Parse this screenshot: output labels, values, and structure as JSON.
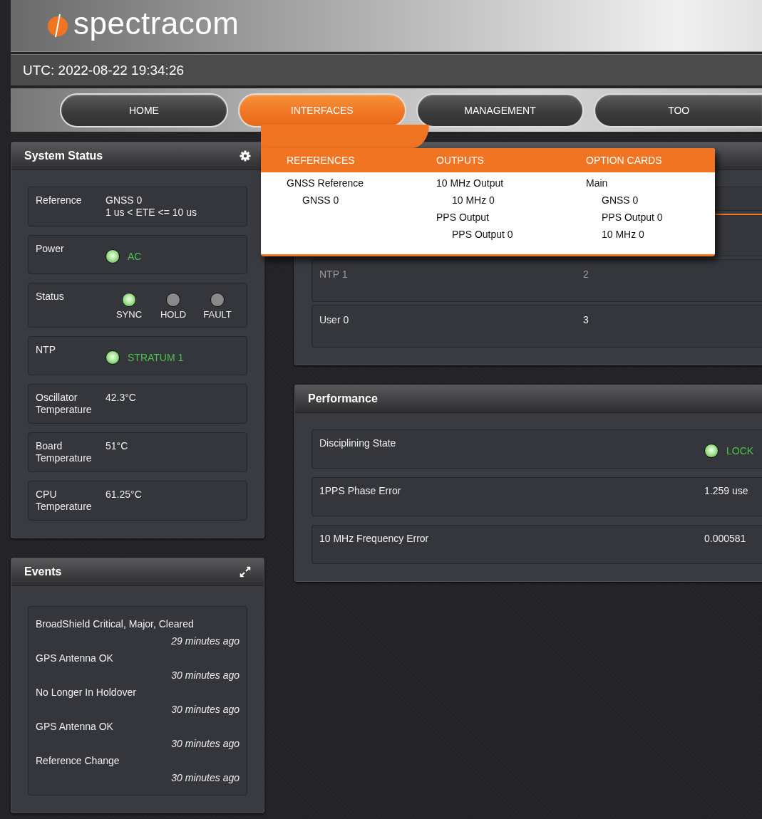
{
  "header": {
    "logo": "spectracom",
    "utc": "UTC: 2022-08-22 19:34:26"
  },
  "nav": {
    "tabs": [
      {
        "label": "HOME",
        "selected": false
      },
      {
        "label": "INTERFACES",
        "selected": true
      },
      {
        "label": "MANAGEMENT",
        "selected": false
      },
      {
        "label": "TOO",
        "selected": false
      }
    ]
  },
  "menu": {
    "columns": [
      {
        "heading": "REFERENCES",
        "items": [
          {
            "label": "GNSS Reference",
            "children": [
              {
                "label": "GNSS 0"
              }
            ]
          }
        ]
      },
      {
        "heading": "OUTPUTS",
        "items": [
          {
            "label": "10 MHz Output",
            "children": [
              {
                "label": "10 MHz 0"
              }
            ]
          },
          {
            "label": "PPS Output",
            "children": [
              {
                "label": "PPS Output 0"
              }
            ]
          }
        ]
      },
      {
        "heading": "OPTION CARDS",
        "items": [
          {
            "label": "Main",
            "children": [
              {
                "label": "GNSS 0"
              },
              {
                "label": "PPS Output 0"
              },
              {
                "label": "10 MHz 0"
              }
            ]
          }
        ]
      }
    ]
  },
  "system_status": {
    "title": "System Status",
    "rows": [
      {
        "kind": "text",
        "label": "Reference",
        "lines": [
          "GNSS 0",
          "1 us < ETE <= 10 us"
        ]
      },
      {
        "kind": "led",
        "label": "Power",
        "leds": [
          {
            "label": "AC",
            "on": true
          }
        ]
      },
      {
        "kind": "indicators",
        "label": "Status",
        "leds": [
          {
            "label": "SYNC",
            "on": true
          },
          {
            "label": "HOLD",
            "on": false
          },
          {
            "label": "FAULT",
            "on": false
          }
        ]
      },
      {
        "kind": "led",
        "label": "NTP",
        "leds": [
          {
            "label": "STRATUM 1",
            "on": true
          }
        ]
      },
      {
        "kind": "text",
        "label": "Oscillator Temperature",
        "lines": [
          "42.3°C"
        ]
      },
      {
        "kind": "text",
        "label": "Board Temperature",
        "lines": [
          "51°C"
        ]
      },
      {
        "kind": "text",
        "label": "CPU Temperature",
        "lines": [
          "61.25°C"
        ]
      }
    ]
  },
  "references_table": {
    "rows": [
      {
        "column_1": "NTP 1",
        "column_2": "2",
        "disabled": true
      },
      {
        "column_1": "User 0",
        "column_2": "3",
        "disabled": false
      }
    ]
  },
  "performance": {
    "title": "Performance",
    "rows": [
      {
        "kind": "led",
        "label": "Disciplining State",
        "leds": [
          {
            "label": "LOCK",
            "on": true
          }
        ]
      },
      {
        "kind": "text",
        "label": "1PPS Phase Error",
        "lines": [
          "1.259 use"
        ]
      },
      {
        "kind": "text",
        "label": "10 MHz Frequency Error",
        "lines": [
          "0.000581"
        ]
      }
    ]
  },
  "events": {
    "title": "Events",
    "items": [
      {
        "message": "BroadShield Critical, Major, Cleared",
        "time": "29 minutes ago"
      },
      {
        "message": "GPS Antenna OK",
        "time": "30 minutes ago"
      },
      {
        "message": "No Longer In Holdover",
        "time": "30 minutes ago"
      },
      {
        "message": "GPS Antenna OK",
        "time": "30 minutes ago"
      },
      {
        "message": "Reference Change",
        "time": "30 minutes ago"
      }
    ]
  }
}
